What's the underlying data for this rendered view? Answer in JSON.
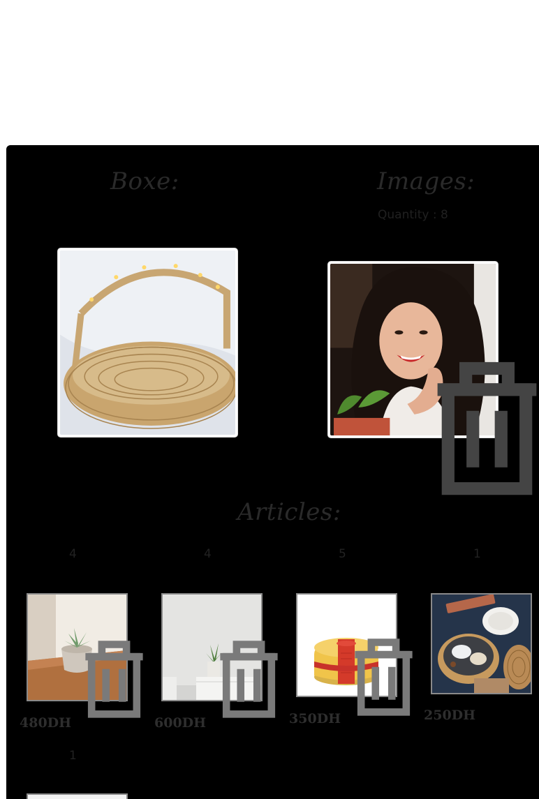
{
  "sections": {
    "boxes_title": "Boxe:",
    "images_title": "Images:",
    "articles_title": "Articles:"
  },
  "images": {
    "quantity_label": "Quantity : 8"
  },
  "articles": [
    {
      "count": "4",
      "price": "480DH",
      "icon": "succulent-pot-photo"
    },
    {
      "count": "4",
      "price": "600DH",
      "icon": "plant-on-cabinet-photo"
    },
    {
      "count": "5",
      "price": "350DH",
      "icon": "pouf-photo"
    },
    {
      "count": "1",
      "price": "250DH",
      "icon": "basket-gift-set-photo"
    },
    {
      "count": "1",
      "price": "",
      "icon": "article-photo"
    }
  ],
  "icons": {
    "delete": "trash-icon"
  },
  "colors": {
    "panel_bg": "#000000",
    "page_bg": "#ffffff",
    "muted_text": "#2a2a2a"
  }
}
